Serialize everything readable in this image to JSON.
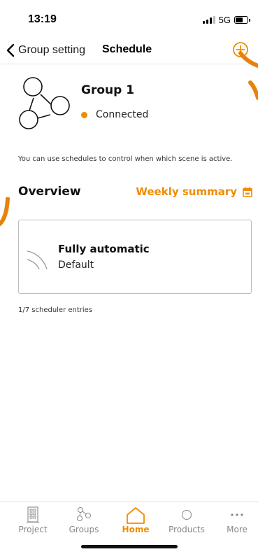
{
  "status_bar": {
    "time": "13:19",
    "network": "5G",
    "battery_level": 0.62
  },
  "nav": {
    "back_label": "Group setting",
    "title": "Schedule"
  },
  "group": {
    "name": "Group 1",
    "status": "Connected"
  },
  "info_text": "You can use schedules to control when which scene is active.",
  "overview": {
    "title": "Overview",
    "weekly_label": "Weekly summary"
  },
  "schedule_card": {
    "title": "Fully automatic",
    "subtitle": "Default"
  },
  "entries_text": "1/7 scheduler entries",
  "tabs": [
    {
      "label": "Project",
      "icon": "building-icon",
      "active": false
    },
    {
      "label": "Groups",
      "icon": "groups-icon",
      "active": false
    },
    {
      "label": "Home",
      "icon": "home-icon",
      "active": true
    },
    {
      "label": "Products",
      "icon": "circle-icon",
      "active": false
    },
    {
      "label": "More",
      "icon": "dots-icon",
      "active": false
    }
  ],
  "colors": {
    "accent": "#f08c00",
    "text": "#111111",
    "border": "#bdbdbd"
  }
}
